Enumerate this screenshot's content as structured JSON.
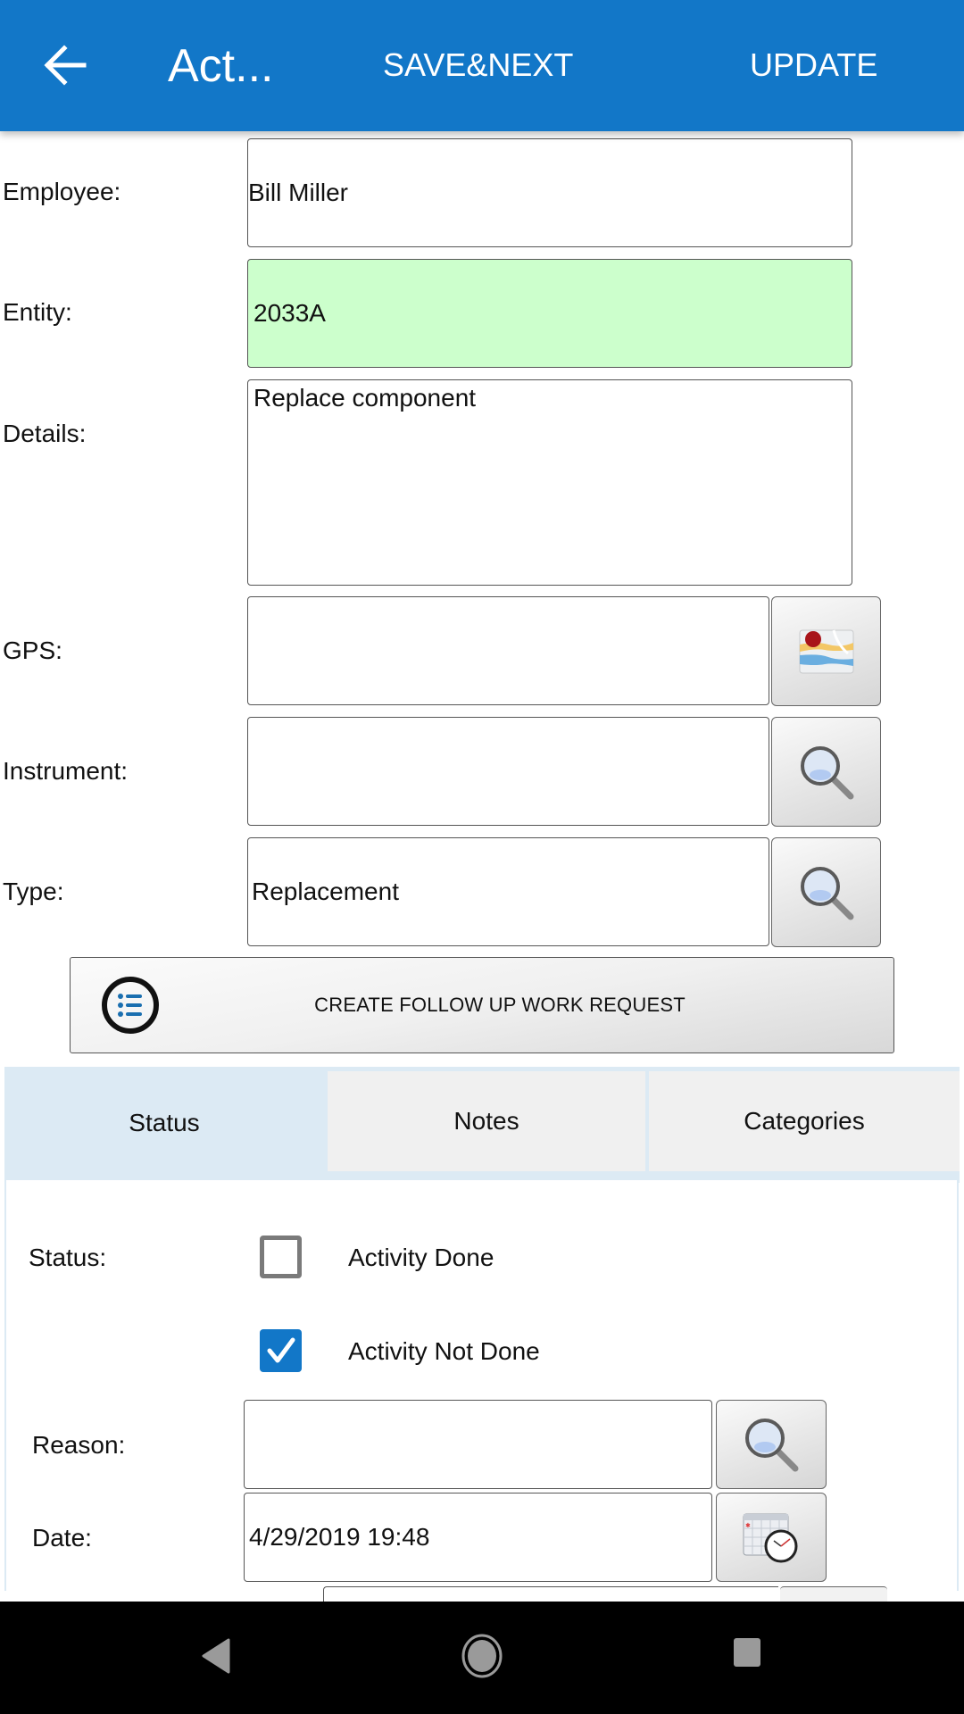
{
  "appbar": {
    "back_icon": "arrow-left-icon",
    "title": "Act...",
    "save_next_label": "SAVE&NEXT",
    "update_label": "UPDATE",
    "color": "#1277c8"
  },
  "form": {
    "employee": {
      "label": "Employee:",
      "value": "Bill Miller"
    },
    "entity": {
      "label": "Entity:",
      "value": "2033A",
      "highlight_color": "#ccffcc"
    },
    "details": {
      "label": "Details:",
      "value": "Replace component"
    },
    "gps": {
      "label": "GPS:",
      "value": "",
      "button_icon": "map-icon"
    },
    "instrument": {
      "label": "Instrument:",
      "value": "",
      "button_icon": "magnifier-icon"
    },
    "type": {
      "label": "Type:",
      "value": "Replacement",
      "button_icon": "magnifier-icon"
    }
  },
  "followup_button": {
    "icon": "list-icon",
    "label": "CREATE FOLLOW UP WORK REQUEST"
  },
  "tabs": [
    {
      "label": "Status",
      "active": true
    },
    {
      "label": "Notes",
      "active": false
    },
    {
      "label": "Categories",
      "active": false
    }
  ],
  "status_panel": {
    "status_label": "Status:",
    "options": [
      {
        "label": "Activity Done",
        "checked": false
      },
      {
        "label": "Activity Not Done",
        "checked": true
      }
    ],
    "reason": {
      "label": "Reason:",
      "value": "",
      "button_icon": "magnifier-icon"
    },
    "date": {
      "label": "Date:",
      "value": "4/29/2019 19:48",
      "button_icon": "calendar-clock-icon"
    }
  },
  "navbar": {
    "back_icon": "nav-back-icon",
    "home_icon": "nav-home-icon",
    "recents_icon": "nav-recents-icon"
  }
}
